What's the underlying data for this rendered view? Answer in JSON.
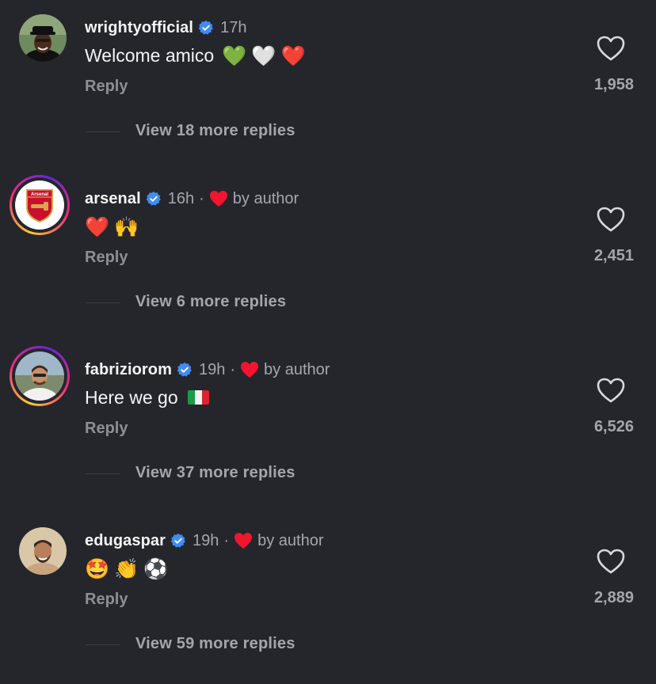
{
  "colors": {
    "background": "#25262b",
    "verified": "#3f8cf5",
    "heart": "#f0162e"
  },
  "comments": [
    {
      "username": "wrightyofficial",
      "time": "17h",
      "liked_by_author": false,
      "text": "Welcome amico",
      "emojis": [
        "💚",
        "🤍",
        "❤️"
      ],
      "reply": "Reply",
      "likes": "1,958",
      "view_replies": "View 18 more replies"
    },
    {
      "username": "arsenal",
      "time": "16h",
      "liked_by_author": true,
      "dot": "·",
      "by_author": "by author",
      "text": "",
      "emojis": [
        "❤️",
        "🙌"
      ],
      "reply": "Reply",
      "likes": "2,451",
      "view_replies": "View 6 more replies",
      "avatar_logo_text": "Arsenal"
    },
    {
      "username": "fabriziorom",
      "time": "19h",
      "liked_by_author": true,
      "dot": "·",
      "by_author": "by author",
      "text": "Here we go",
      "emojis": [
        "🇮🇹"
      ],
      "reply": "Reply",
      "likes": "6,526",
      "view_replies": "View 37 more replies"
    },
    {
      "username": "edugaspar",
      "time": "19h",
      "liked_by_author": true,
      "dot": "·",
      "by_author": "by author",
      "text": "",
      "emojis": [
        "🤩",
        "👏",
        "⚽"
      ],
      "reply": "Reply",
      "likes": "2,889",
      "view_replies": "View 59 more replies"
    }
  ]
}
